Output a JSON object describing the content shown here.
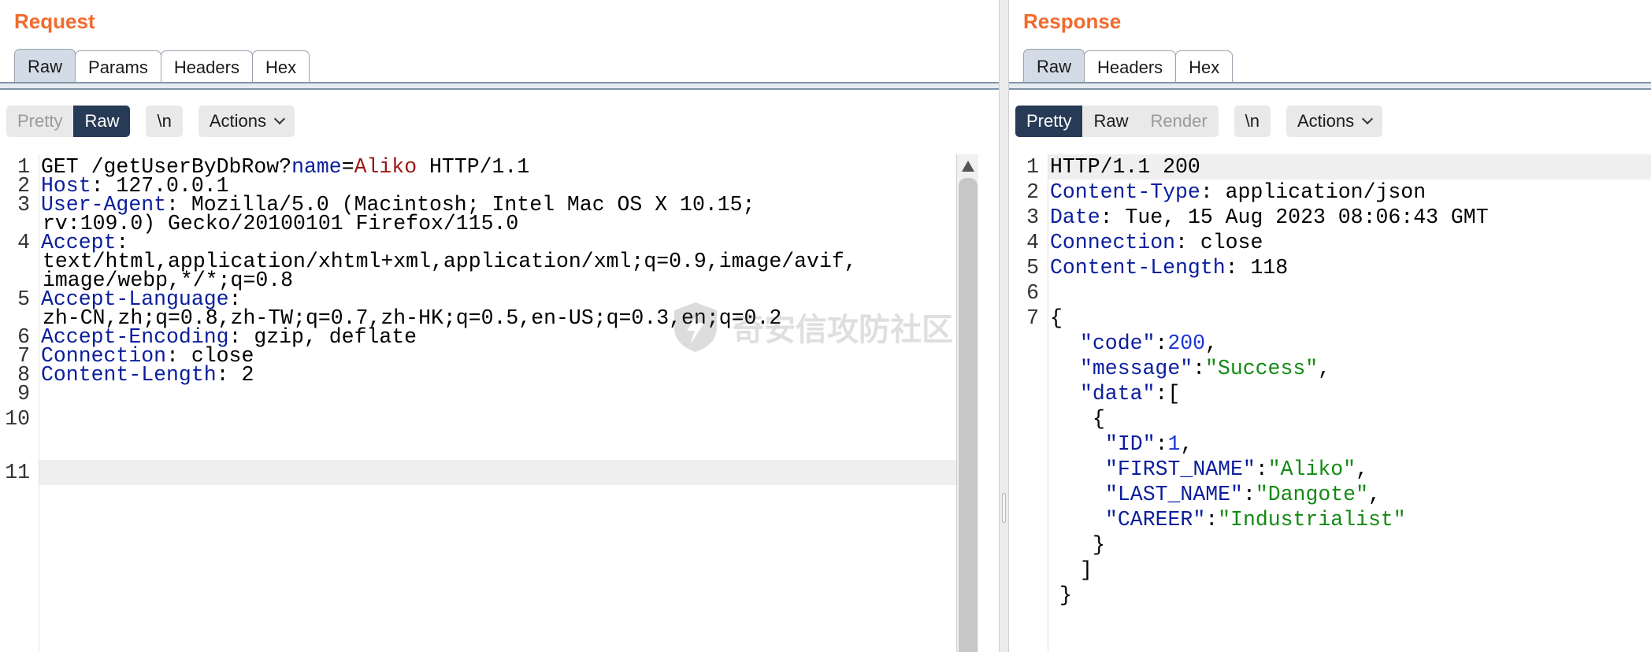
{
  "request": {
    "title": "Request",
    "tabs": [
      "Raw",
      "Params",
      "Headers",
      "Hex"
    ],
    "active_tab": "Raw",
    "view_modes": [
      "Pretty",
      "Raw"
    ],
    "active_view": "Raw",
    "newline_label": "\\n",
    "actions_label": "Actions",
    "line_numbers": [
      "1",
      "2",
      "3",
      "4",
      "5",
      "6",
      "7",
      "8",
      "9",
      "10",
      "11"
    ],
    "line1": {
      "prefix": "GET /getUserByDbRow?",
      "param_name": "name",
      "eq": "=",
      "param_value": "Aliko",
      "suffix": " HTTP/1.1"
    },
    "line2": {
      "key": "Host",
      "value": ": 127.0.0.1"
    },
    "line3": {
      "key": "User-Agent",
      "value": ": Mozilla/5.0 (Macintosh; Intel Mac OS X 10.15;",
      "cont": "rv:109.0) Gecko/20100101 Firefox/115.0"
    },
    "line4": {
      "key": "Accept",
      "value": ":",
      "cont1": "text/html,application/xhtml+xml,application/xml;q=0.9,image/avif,",
      "cont2": "image/webp,*/*;q=0.8"
    },
    "line5": {
      "key": "Accept-Language",
      "value": ":",
      "cont": "zh-CN,zh;q=0.8,zh-TW;q=0.7,zh-HK;q=0.5,en-US;q=0.3,en;q=0.2"
    },
    "line6": {
      "key": "Accept-Encoding",
      "value": ": gzip, deflate"
    },
    "line7": {
      "key": "Connection",
      "value": ": close"
    },
    "line8": {
      "key": "Content-Length",
      "value": ": 2"
    }
  },
  "response": {
    "title": "Response",
    "tabs": [
      "Raw",
      "Headers",
      "Hex"
    ],
    "active_tab": "Raw",
    "view_modes": [
      "Pretty",
      "Raw",
      "Render"
    ],
    "active_view": "Pretty",
    "newline_label": "\\n",
    "actions_label": "Actions",
    "line_numbers": [
      "1",
      "2",
      "3",
      "4",
      "5",
      "6",
      "7"
    ],
    "status_line": "HTTP/1.1 200",
    "headers": [
      {
        "key": "Content-Type",
        "value": ": application/json"
      },
      {
        "key": "Date",
        "value": ": Tue, 15 Aug 2023 08:06:43 GMT"
      },
      {
        "key": "Connection",
        "value": ": close"
      },
      {
        "key": "Content-Length",
        "value": ": 118"
      }
    ],
    "json": {
      "open_brace": "{",
      "code_key": "\"code\"",
      "code_value": "200",
      "message_key": "\"message\"",
      "message_value": "\"Success\"",
      "data_key": "\"data\"",
      "open_bracket": "[",
      "obj_open": "{",
      "id_key": "\"ID\"",
      "id_value": "1",
      "first_name_key": "\"FIRST_NAME\"",
      "first_name_value": "\"Aliko\"",
      "last_name_key": "\"LAST_NAME\"",
      "last_name_value": "\"Dangote\"",
      "career_key": "\"CAREER\"",
      "career_value": "\"Industrialist\"",
      "obj_close": "}",
      "close_bracket": "]",
      "close_brace": "}"
    }
  },
  "watermark": "奇安信攻防社区",
  "colors": {
    "title": "#f26a2e",
    "header_key": "#0a1e9c",
    "param_value": "#9c1616",
    "json_string": "#138a13",
    "json_number": "#1a35d6",
    "active_toggle": "#273a56"
  }
}
